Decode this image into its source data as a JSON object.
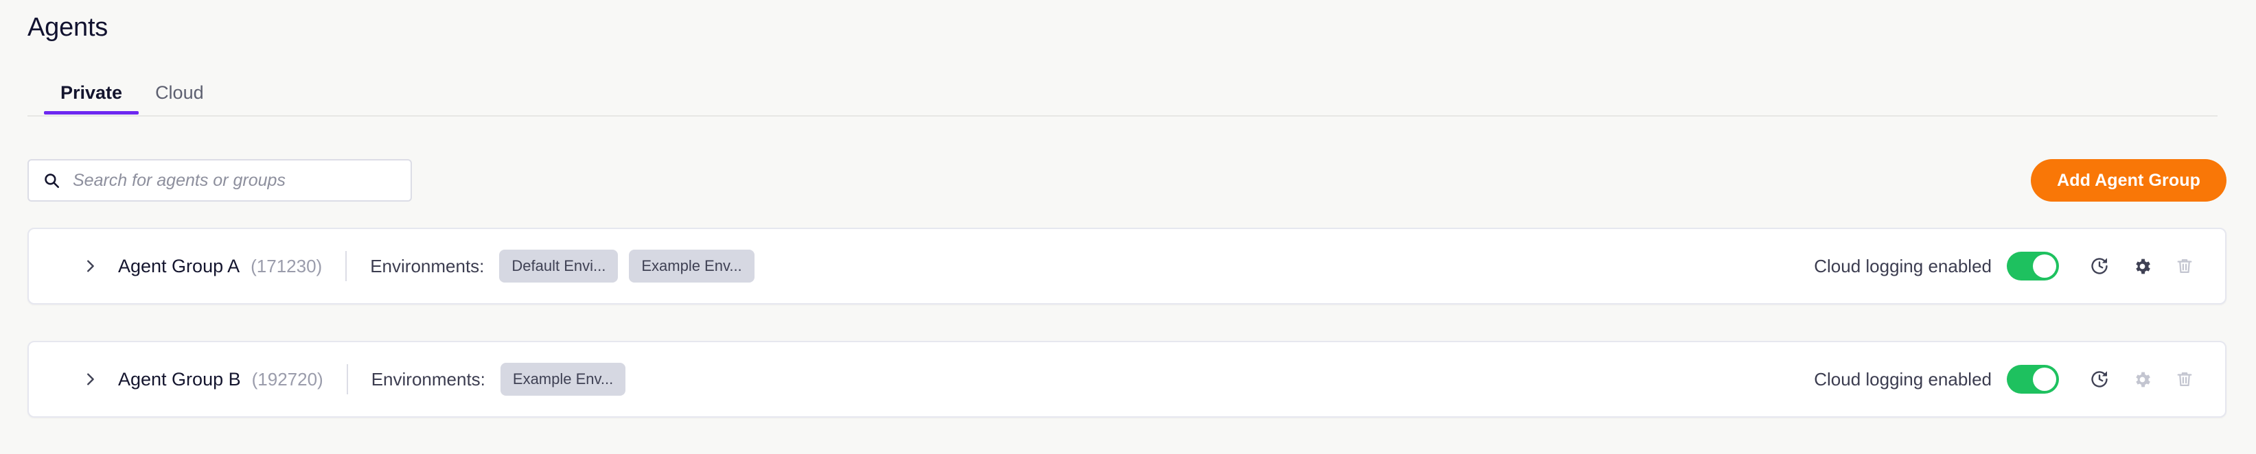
{
  "header": {
    "title": "Agents"
  },
  "tabs": [
    {
      "label": "Private",
      "active": true
    },
    {
      "label": "Cloud",
      "active": false
    }
  ],
  "toolbar": {
    "search": {
      "icon": "search-icon",
      "value": "",
      "placeholder": "Search for agents or groups"
    },
    "add_button_label": "Add Agent Group",
    "add_button_color": "#f97707"
  },
  "colors": {
    "page_background": "#f8f8f6",
    "accent_tab": "#6d28f0",
    "toggle_on": "#1ec15f",
    "chip_background": "#d6d8e2",
    "title_text": "#11122f"
  },
  "groups": [
    {
      "chevron_icon": "chevron-right-icon",
      "name": "Agent Group A",
      "id": "(171230)",
      "environments_label": "Environments:",
      "environments": [
        "Default Envi...",
        "Example Env..."
      ],
      "cloud_logging_label": "Cloud logging enabled",
      "cloud_logging_enabled": true,
      "actions": [
        {
          "icon": "history-restore-icon",
          "enabled": true
        },
        {
          "icon": "gear-icon",
          "enabled": true
        },
        {
          "icon": "trash-icon",
          "enabled": false
        }
      ]
    },
    {
      "chevron_icon": "chevron-right-icon",
      "name": "Agent Group B",
      "id": "(192720)",
      "environments_label": "Environments:",
      "environments": [
        "Example Env..."
      ],
      "cloud_logging_label": "Cloud logging enabled",
      "cloud_logging_enabled": true,
      "actions": [
        {
          "icon": "history-restore-icon",
          "enabled": true
        },
        {
          "icon": "gear-icon",
          "enabled": false
        },
        {
          "icon": "trash-icon",
          "enabled": false
        }
      ]
    }
  ]
}
